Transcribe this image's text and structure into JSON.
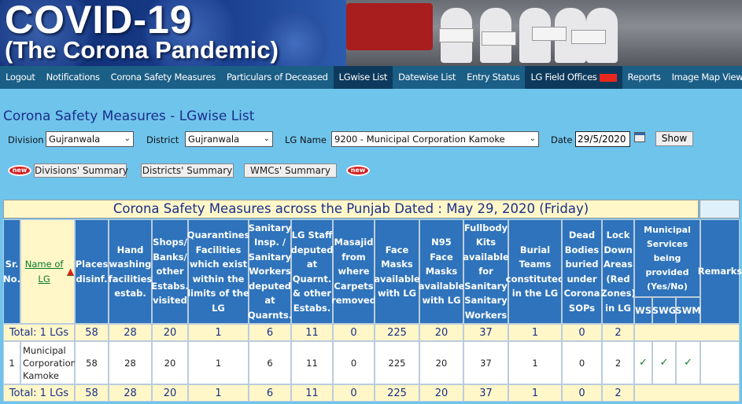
{
  "banner": {
    "title_line1": "COVID-19",
    "title_line2": "(The Corona Pandemic)"
  },
  "nav": {
    "items": [
      {
        "label": "Logout"
      },
      {
        "label": "Notifications"
      },
      {
        "label": "Corona Safety Measures"
      },
      {
        "label": "Particulars of Deceased"
      },
      {
        "label": "LGwise List"
      },
      {
        "label": "Datewise List"
      },
      {
        "label": "Entry Status"
      },
      {
        "label": "LG Field Offices"
      },
      {
        "label": "Reports"
      },
      {
        "label": "Image Map Viewer"
      }
    ]
  },
  "page": {
    "title": "Corona Safety Measures - LGwise List"
  },
  "filters": {
    "division_label": "Division",
    "division_value": "Gujranwala",
    "district_label": "District",
    "district_value": "Gujranwala",
    "lg_label": "LG Name",
    "lg_value": "9200 - Municipal Corporation Kamoke",
    "date_label": "Date",
    "date_value": "29/5/2020",
    "show_label": "Show"
  },
  "summary": {
    "new_badge": "new",
    "divisions": "Divisions' Summary",
    "districts": "Districts' Summary",
    "wmcs": "WMCs' Summary"
  },
  "table": {
    "caption": "Corona Safety Measures across the Punjab Dated : May 29, 2020 (Friday)",
    "headers": {
      "sr": "Sr. No.",
      "name": "Name of LG",
      "places": "Places disinf.",
      "hand": "Hand washing facilities estab.",
      "shops": "Shops/ Banks/ other Estabs. visited",
      "quarantines": "Quarantines Facilities which exist within the limits of the LG",
      "sanitary": "Sanitary Insp. / Sanitary Workers deputed at Quarnts.",
      "staff": "LG Staff deputed at Quarnt. & other Estabs.",
      "masajid": "Masajid from where Carpets removed",
      "face": "Face Masks available with LG",
      "n95": "N95 Face Masks available with LG",
      "fullbody": "Fullbody Kits available for Sanitary Sanitary Workers",
      "burial": "Burial Teams constituted in the LG",
      "dead": "Dead Bodies buried under Corona SOPs",
      "lockdown": "Lock Down Areas (Red Zones) in LG",
      "municipal": "Municipal Services being provided (Yes/No)",
      "ws": "WS",
      "swg": "SWG",
      "swm": "SWM",
      "remarks": "Remarks"
    },
    "total_label": "Total: 1 LGs",
    "totals": [
      "58",
      "28",
      "20",
      "1",
      "6",
      "11",
      "0",
      "225",
      "20",
      "37",
      "1",
      "0",
      "2"
    ],
    "rows": [
      {
        "sr": "1",
        "name": "Municipal Corporation Kamoke",
        "values": [
          "58",
          "28",
          "20",
          "1",
          "6",
          "11",
          "0",
          "225",
          "20",
          "37",
          "1",
          "0",
          "2"
        ],
        "ws": "✓",
        "swg": "✓",
        "swm": "✓",
        "remarks": ""
      }
    ]
  }
}
